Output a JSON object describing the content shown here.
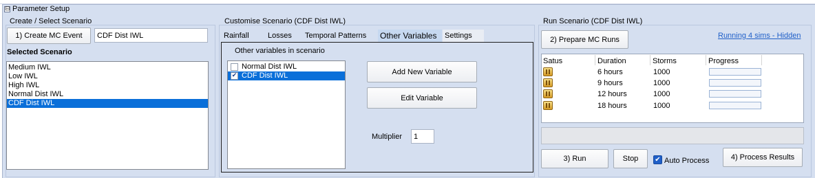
{
  "panel": {
    "title": "Parameter Setup",
    "collapse_glyph": "⊟"
  },
  "create": {
    "group_title": "Create / Select Scenario",
    "create_button": "1) Create MC Event",
    "name_value": "CDF Dist IWL",
    "selected_label": "Selected Scenario",
    "scenarios": [
      "Medium IWL",
      "Low IWL",
      "High IWL",
      "Normal Dist IWL",
      "CDF Dist IWL"
    ],
    "selected_index": 4
  },
  "customise": {
    "group_title": "Customise Scenario (CDF Dist IWL)",
    "tabs": [
      "Rainfall",
      "Losses",
      "Temporal Patterns",
      "Other Variables",
      "Settings"
    ],
    "active_tab": "Other Variables",
    "variables_label": "Other variables in scenario",
    "variables": [
      {
        "name": "Normal Dist IWL",
        "checked": false
      },
      {
        "name": "CDF Dist IWL",
        "checked": true
      }
    ],
    "add_button": "Add New Variable",
    "edit_button": "Edit Variable",
    "multiplier_label": "Multiplier",
    "multiplier_value": "1"
  },
  "run": {
    "group_title": "Run Scenario (CDF Dist IWL)",
    "prepare_button": "2) Prepare MC Runs",
    "running_link": "Running 4 sims - Hidden",
    "columns": [
      "Satus",
      "Duration",
      "Storms",
      "Progress"
    ],
    "rows": [
      {
        "status_icon": "paused-icon",
        "duration": "6 hours",
        "storms": "1000",
        "progress": 0
      },
      {
        "status_icon": "paused-icon",
        "duration": "9 hours",
        "storms": "1000",
        "progress": 0
      },
      {
        "status_icon": "paused-icon",
        "duration": "12 hours",
        "storms": "1000",
        "progress": 0
      },
      {
        "status_icon": "paused-icon",
        "duration": "18 hours",
        "storms": "1000",
        "progress": 0
      }
    ],
    "run_button": "3) Run",
    "stop_button": "Stop",
    "auto_process_label": "Auto Process",
    "auto_process_checked": true,
    "process_button": "4) Process Results"
  },
  "colors": {
    "panel_bg": "#d5dff0",
    "selection": "#0a6fd9",
    "link": "#1f5fc8"
  }
}
